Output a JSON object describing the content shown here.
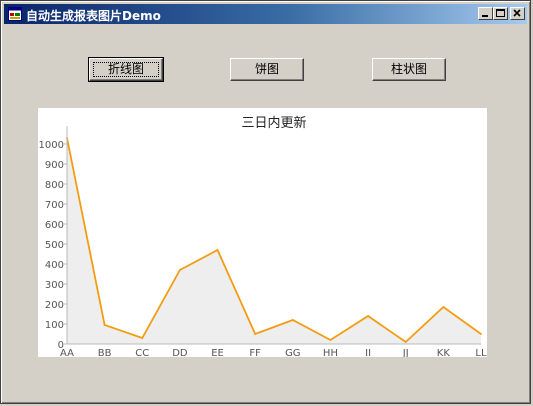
{
  "window": {
    "title": "自动生成报表图片Demo"
  },
  "buttons": {
    "line": "折线图",
    "pie": "饼图",
    "bar": "柱状图"
  },
  "chart_data": {
    "type": "area",
    "title": "三日内更新",
    "xlabel": "",
    "ylabel": "",
    "categories": [
      "AA",
      "BB",
      "CC",
      "DD",
      "EE",
      "FF",
      "GG",
      "HH",
      "II",
      "JJ",
      "KK",
      "LL"
    ],
    "values": [
      1030,
      95,
      30,
      370,
      470,
      50,
      120,
      20,
      140,
      10,
      185,
      50
    ],
    "ylim": [
      0,
      1050
    ],
    "yticks": [
      0,
      100,
      200,
      300,
      400,
      500,
      600,
      700,
      800,
      900,
      1000
    ],
    "line_color": "#f39c12",
    "fill_color": "#eeeeee",
    "grid": false
  }
}
